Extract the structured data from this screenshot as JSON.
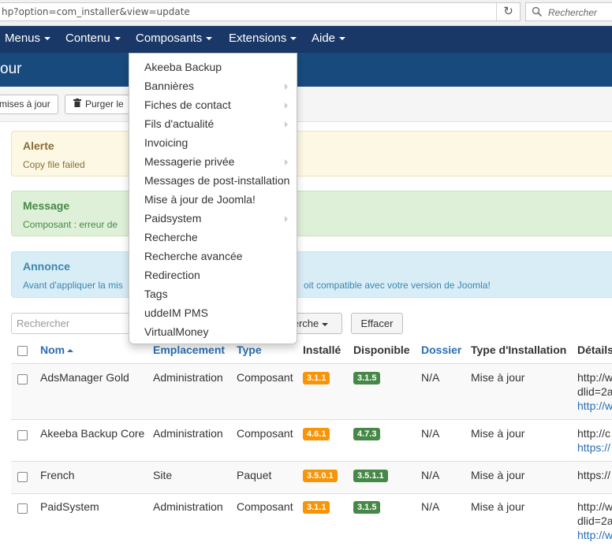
{
  "browser": {
    "url": "hp?option=com_installer&view=update",
    "search_placeholder": "Rechercher"
  },
  "topnav": {
    "items": [
      {
        "label": "Menus"
      },
      {
        "label": "Contenu"
      },
      {
        "label": "Composants"
      },
      {
        "label": "Extensions"
      },
      {
        "label": "Aide"
      }
    ]
  },
  "subhead": {
    "title": "our"
  },
  "toolbar": {
    "update_label": "mises à jour",
    "purge_label": "Purger le"
  },
  "alerts": {
    "warning": {
      "heading": "Alerte",
      "body": "Copy file failed"
    },
    "message": {
      "heading": "Message",
      "body": "Composant : erreur de"
    },
    "notice": {
      "heading": "Annonce",
      "body_left": "Avant d'appliquer la mis",
      "body_right": "oit compatible avec votre version de Joomla!"
    }
  },
  "filters": {
    "search_placeholder": "Rechercher",
    "search_button": "erche",
    "clear_button": "Effacer"
  },
  "table": {
    "headers": {
      "name": "Nom",
      "location": "Emplacement",
      "type": "Type",
      "installed": "Installé",
      "available": "Disponible",
      "folder": "Dossier",
      "install_type": "Type d'Installation",
      "details": "Détails"
    },
    "rows": [
      {
        "name": "AdsManager Gold",
        "location": "Administration",
        "type": "Composant",
        "installed": "3.1.1",
        "available": "3.1.5",
        "folder": "N/A",
        "install_type": "Mise à jour",
        "details_1": "http://w",
        "details_2": "dlid=2a",
        "details_3": "http://w"
      },
      {
        "name": "Akeeba Backup Core",
        "location": "Administration",
        "type": "Composant",
        "installed": "4.6.1",
        "available": "4.7.3",
        "folder": "N/A",
        "install_type": "Mise à jour",
        "details_1": "http://c",
        "details_2": "https://"
      },
      {
        "name": "French",
        "location": "Site",
        "type": "Paquet",
        "installed": "3.5.0.1",
        "available": "3.5.1.1",
        "folder": "N/A",
        "install_type": "Mise à jour",
        "details_1": "https://"
      },
      {
        "name": "PaidSystem",
        "location": "Administration",
        "type": "Composant",
        "installed": "3.1.1",
        "available": "3.1.5",
        "folder": "N/A",
        "install_type": "Mise à jour",
        "details_1": "http://w",
        "details_2": "dlid=2a",
        "details_3": "http://w"
      }
    ]
  },
  "menu": {
    "items": [
      {
        "label": "Akeeba Backup",
        "submenu": false
      },
      {
        "label": "Bannières",
        "submenu": true
      },
      {
        "label": "Fiches de contact",
        "submenu": true
      },
      {
        "label": "Fils d'actualité",
        "submenu": true
      },
      {
        "label": "Invoicing",
        "submenu": false
      },
      {
        "label": "Messagerie privée",
        "submenu": true
      },
      {
        "label": "Messages de post-installation",
        "submenu": false
      },
      {
        "label": "Mise à jour de Joomla!",
        "submenu": false
      },
      {
        "label": "Paidsystem",
        "submenu": true
      },
      {
        "label": "Recherche",
        "submenu": false
      },
      {
        "label": "Recherche avancée",
        "submenu": false
      },
      {
        "label": "Redirection",
        "submenu": false
      },
      {
        "label": "Tags",
        "submenu": false
      },
      {
        "label": "uddeIM PMS",
        "submenu": false
      },
      {
        "label": "VirtualMoney",
        "submenu": false
      }
    ]
  },
  "colors": {
    "nav_bg": "#1a3867",
    "subhead_bg": "#184a7d",
    "link": "#2a6fb3",
    "badge_installed": "#f89406",
    "badge_available": "#468847"
  }
}
